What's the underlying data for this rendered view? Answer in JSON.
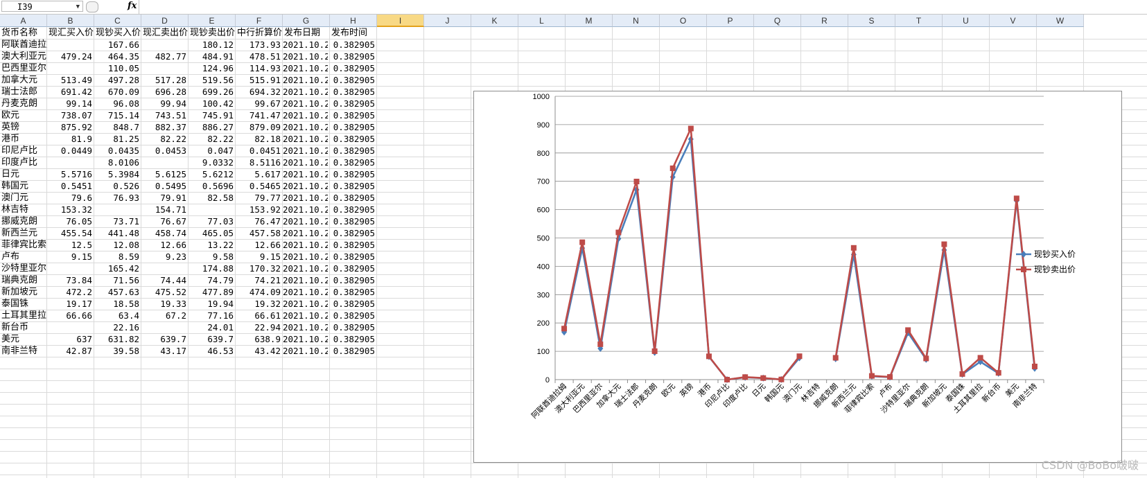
{
  "formula_bar": {
    "name_box": "I39",
    "fx_label": "fx",
    "formula": ""
  },
  "columns": [
    "A",
    "B",
    "C",
    "D",
    "E",
    "F",
    "G",
    "H",
    "I",
    "J",
    "K",
    "L",
    "M",
    "N",
    "O",
    "P",
    "Q",
    "R",
    "S",
    "T",
    "U",
    "V",
    "W"
  ],
  "selected_column": "I",
  "table": {
    "headers": [
      "货币名称",
      "现汇买入价",
      "现钞买入价",
      "现汇卖出价",
      "现钞卖出价",
      "中行折算价",
      "发布日期",
      "发布时间"
    ],
    "rows": [
      [
        "阿联酋迪拉姆",
        "",
        "167.66",
        "",
        "180.12",
        "173.93",
        "2021.10.2",
        "0.382905"
      ],
      [
        "澳大利亚元",
        "479.24",
        "464.35",
        "482.77",
        "484.91",
        "478.51",
        "2021.10.2",
        "0.382905"
      ],
      [
        "巴西里亚尔",
        "",
        "110.05",
        "",
        "124.96",
        "114.93",
        "2021.10.2",
        "0.382905"
      ],
      [
        "加拿大元",
        "513.49",
        "497.28",
        "517.28",
        "519.56",
        "515.91",
        "2021.10.2",
        "0.382905"
      ],
      [
        "瑞士法郎",
        "691.42",
        "670.09",
        "696.28",
        "699.26",
        "694.32",
        "2021.10.2",
        "0.382905"
      ],
      [
        "丹麦克朗",
        "99.14",
        "96.08",
        "99.94",
        "100.42",
        "99.67",
        "2021.10.2",
        "0.382905"
      ],
      [
        "欧元",
        "738.07",
        "715.14",
        "743.51",
        "745.91",
        "741.47",
        "2021.10.2",
        "0.382905"
      ],
      [
        "英镑",
        "875.92",
        "848.7",
        "882.37",
        "886.27",
        "879.09",
        "2021.10.2",
        "0.382905"
      ],
      [
        "港币",
        "81.9",
        "81.25",
        "82.22",
        "82.22",
        "82.18",
        "2021.10.2",
        "0.382905"
      ],
      [
        "印尼卢比",
        "0.0449",
        "0.0435",
        "0.0453",
        "0.047",
        "0.0451",
        "2021.10.2",
        "0.382905"
      ],
      [
        "印度卢比",
        "",
        "8.0106",
        "",
        "9.0332",
        "8.5116",
        "2021.10.2",
        "0.382905"
      ],
      [
        "日元",
        "5.5716",
        "5.3984",
        "5.6125",
        "5.6212",
        "5.617",
        "2021.10.2",
        "0.382905"
      ],
      [
        "韩国元",
        "0.5451",
        "0.526",
        "0.5495",
        "0.5696",
        "0.5465",
        "2021.10.2",
        "0.382905"
      ],
      [
        "澳门元",
        "79.6",
        "76.93",
        "79.91",
        "82.58",
        "79.77",
        "2021.10.2",
        "0.382905"
      ],
      [
        "林吉特",
        "153.32",
        "",
        "154.71",
        "",
        "153.92",
        "2021.10.2",
        "0.382905"
      ],
      [
        "挪威克朗",
        "76.05",
        "73.71",
        "76.67",
        "77.03",
        "76.47",
        "2021.10.2",
        "0.382905"
      ],
      [
        "新西兰元",
        "455.54",
        "441.48",
        "458.74",
        "465.05",
        "457.58",
        "2021.10.2",
        "0.382905"
      ],
      [
        "菲律宾比索",
        "12.5",
        "12.08",
        "12.66",
        "13.22",
        "12.66",
        "2021.10.2",
        "0.382905"
      ],
      [
        "卢布",
        "9.15",
        "8.59",
        "9.23",
        "9.58",
        "9.15",
        "2021.10.2",
        "0.382905"
      ],
      [
        "沙特里亚尔",
        "",
        "165.42",
        "",
        "174.88",
        "170.32",
        "2021.10.2",
        "0.382905"
      ],
      [
        "瑞典克朗",
        "73.84",
        "71.56",
        "74.44",
        "74.79",
        "74.21",
        "2021.10.2",
        "0.382905"
      ],
      [
        "新加坡元",
        "472.2",
        "457.63",
        "475.52",
        "477.89",
        "474.09",
        "2021.10.2",
        "0.382905"
      ],
      [
        "泰国铢",
        "19.17",
        "18.58",
        "19.33",
        "19.94",
        "19.32",
        "2021.10.2",
        "0.382905"
      ],
      [
        "土耳其里拉",
        "66.66",
        "63.4",
        "67.2",
        "77.16",
        "66.61",
        "2021.10.2",
        "0.382905"
      ],
      [
        "新台币",
        "",
        "22.16",
        "",
        "24.01",
        "22.94",
        "2021.10.2",
        "0.382905"
      ],
      [
        "美元",
        "637",
        "631.82",
        "639.7",
        "639.7",
        "638.9",
        "2021.10.2",
        "0.382905"
      ],
      [
        "南非兰特",
        "42.87",
        "39.58",
        "43.17",
        "46.53",
        "43.42",
        "2021.10.2",
        "0.382905"
      ]
    ]
  },
  "chart_data": {
    "type": "line",
    "title": "",
    "xlabel": "",
    "ylabel": "",
    "ylim": [
      0,
      1000
    ],
    "yticks": [
      "0",
      "100",
      "200",
      "300",
      "400",
      "500",
      "600",
      "700",
      "800",
      "900",
      "1000"
    ],
    "grid": true,
    "legend": "right",
    "categories": [
      "阿联酋迪拉姆",
      "澳大利亚元",
      "巴西里亚尔",
      "加拿大元",
      "瑞士法郎",
      "丹麦克朗",
      "欧元",
      "英镑",
      "港币",
      "印尼卢比",
      "印度卢比",
      "日元",
      "韩国元",
      "澳门元",
      "林吉特",
      "挪威克朗",
      "新西兰元",
      "菲律宾比索",
      "卢布",
      "沙特里亚尔",
      "瑞典克朗",
      "新加坡元",
      "泰国铢",
      "土耳其里拉",
      "新台币",
      "美元",
      "南非兰特"
    ],
    "series": [
      {
        "name": "现钞买入价",
        "color": "#4a7ebb",
        "marker": "diamond",
        "values": [
          167.66,
          464.35,
          110.05,
          497.28,
          670.09,
          96.08,
          715.14,
          848.7,
          81.25,
          0.0435,
          8.0106,
          5.3984,
          0.526,
          76.93,
          null,
          73.71,
          441.48,
          12.08,
          8.59,
          165.42,
          71.56,
          457.63,
          18.58,
          63.4,
          22.16,
          631.82,
          39.58
        ]
      },
      {
        "name": "现钞卖出价",
        "color": "#be4b48",
        "marker": "square",
        "values": [
          180.12,
          484.91,
          124.96,
          519.56,
          699.26,
          100.42,
          745.91,
          886.27,
          82.22,
          0.047,
          9.0332,
          5.6212,
          0.5696,
          82.58,
          null,
          77.03,
          465.05,
          13.22,
          9.58,
          174.88,
          74.79,
          477.89,
          19.94,
          77.16,
          24.01,
          639.7,
          46.53
        ]
      }
    ]
  },
  "watermark": "CSDN @BoBo啵啵"
}
